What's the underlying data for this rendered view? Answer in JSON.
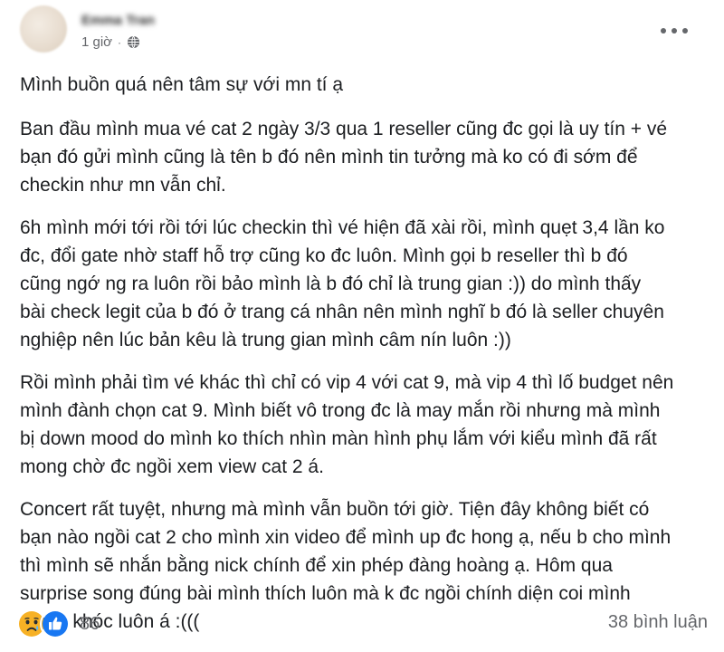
{
  "post": {
    "author": "Emma Tran",
    "time": "1 giờ",
    "separator": "·",
    "privacy_icon": "globe-icon",
    "menu_icon": "more-options-icon",
    "paragraphs": [
      "Mình buồn quá nên tâm sự với mn tí ạ",
      "Ban đầu mình mua vé cat 2 ngày 3/3 qua 1 reseller cũng đc gọi là uy tín + vé\nbạn đó gửi mình cũng là tên b đó nên mình tin tưởng mà ko có đi sớm để\ncheckin như mn vẫn chỉ.",
      "6h mình mới tới rồi tới lúc checkin thì vé hiện đã xài rồi, mình quẹt 3,4 lần ko\nđc, đổi gate nhờ staff hỗ trợ cũng ko đc luôn. Mình gọi b reseller thì b đó\ncũng ngớ ng ra luôn rồi bảo mình là b đó chỉ là trung gian :)) do mình thấy\nbài check legit của b đó ở trang cá nhân nên mình nghĩ b đó là seller chuyên\nnghiệp nên lúc bản kêu là trung gian mình câm nín luôn :))",
      "Rồi mình phải tìm vé khác thì chỉ có vip 4 với cat 9, mà vip 4 thì lố budget nên\nmình đành chọn cat 9. Mình biết vô trong đc là may mắn rồi nhưng mà mình\nbị down mood do mình ko thích nhìn màn hình phụ lắm với kiểu mình đã rất\nmong chờ đc ngồi xem view cat 2 á.",
      "Concert rất tuyệt, nhưng mà mình vẫn buồn tới giờ. Tiện đây không biết có\nbạn nào ngồi cat 2 cho mình xin video để mình up đc hong ạ, nếu b cho mình\nthì mình sẽ nhắn bằng nick chính để xin phép đàng hoàng ạ. Hôm qua\nsurprise song đúng bài mình thích luôn mà k đc ngồi chính diện coi mình\nmuốn khóc luôn á :((("
    ],
    "reactions": {
      "icons": [
        "sad-reaction-icon",
        "like-reaction-icon"
      ],
      "count": "86"
    },
    "comments": "38 bình luận",
    "colors": {
      "text": "#1c1e21",
      "secondary": "#65676b",
      "like_blue": "#1877f2",
      "sad_yellow": "#f7b125"
    }
  }
}
